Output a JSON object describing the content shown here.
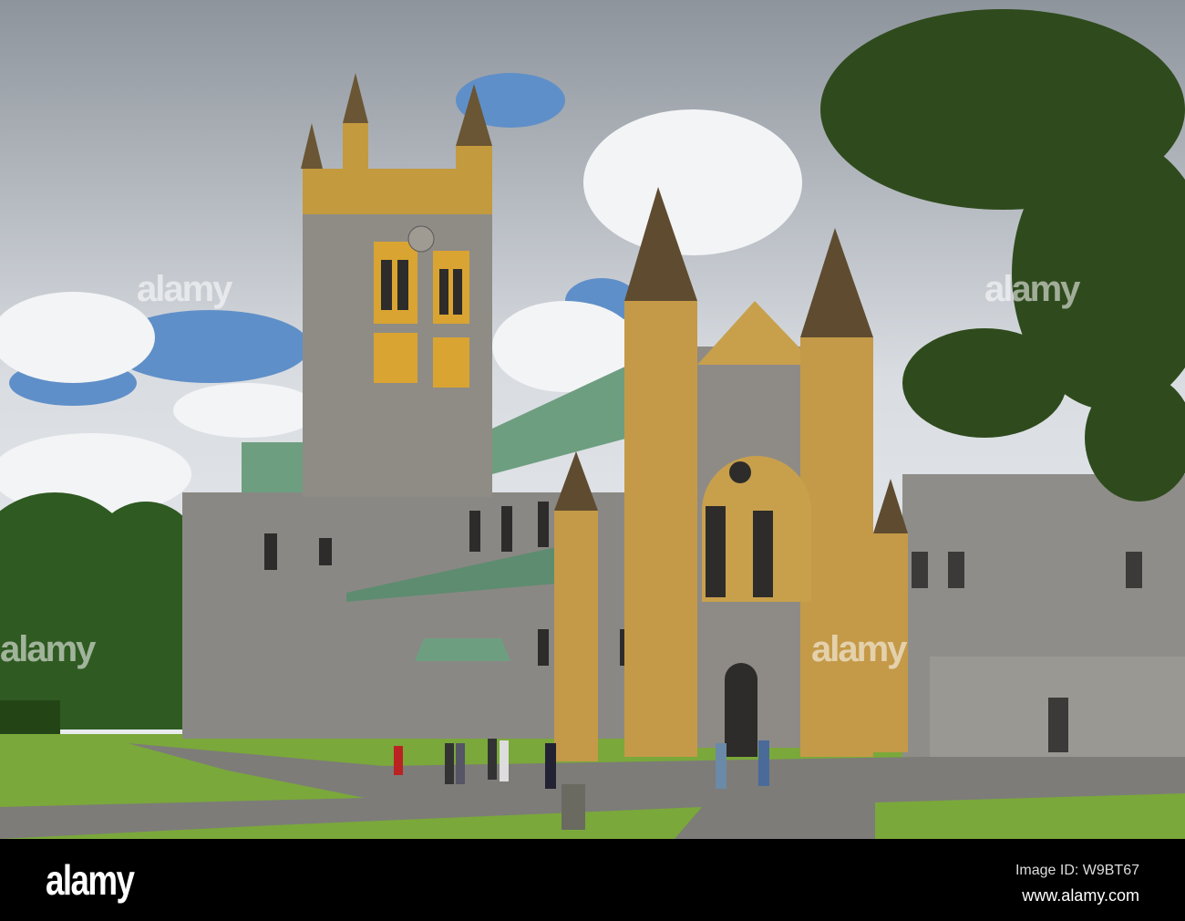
{
  "photo": {
    "subject": "Abbey church with tower, west front and lawn"
  },
  "watermark": {
    "text": "alamy"
  },
  "footer": {
    "logo": "alamy",
    "image_id": "Image ID: W9BT67",
    "website": "www.alamy.com"
  }
}
